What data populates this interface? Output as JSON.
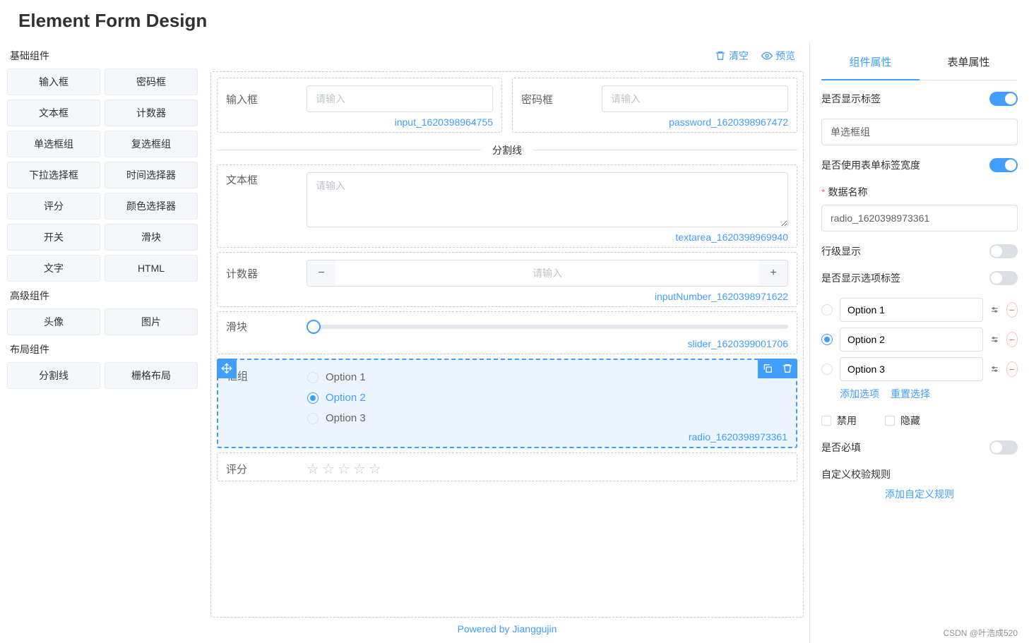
{
  "title": "Element Form Design",
  "sidebar": {
    "groups": [
      {
        "title": "基础组件",
        "items": [
          "输入框",
          "密码框",
          "文本框",
          "计数器",
          "单选框组",
          "复选框组",
          "下拉选择框",
          "时间选择器",
          "评分",
          "颜色选择器",
          "开关",
          "滑块",
          "文字",
          "HTML"
        ]
      },
      {
        "title": "高级组件",
        "items": [
          "头像",
          "图片"
        ]
      },
      {
        "title": "布局组件",
        "items": [
          "分割线",
          "栅格布局"
        ]
      }
    ]
  },
  "toolbar": {
    "clear": "清空",
    "preview": "预览"
  },
  "canvas": {
    "input": {
      "label": "输入框",
      "placeholder": "请输入",
      "id": "input_1620398964755"
    },
    "password": {
      "label": "密码框",
      "placeholder": "请输入",
      "id": "password_1620398967472"
    },
    "divider": {
      "text": "分割线"
    },
    "textarea": {
      "label": "文本框",
      "placeholder": "请输入",
      "id": "textarea_1620398969940"
    },
    "number": {
      "label": "计数器",
      "placeholder": "请输入",
      "id": "inputNumber_1620398971622"
    },
    "slider": {
      "label": "滑块",
      "id": "slider_1620399001706"
    },
    "radio": {
      "label": "框组",
      "id": "radio_1620398973361",
      "options": [
        "Option 1",
        "Option 2",
        "Option 3"
      ],
      "selected": 1
    },
    "rate": {
      "label": "评分"
    }
  },
  "footer": "Powered by Jianggujin",
  "props": {
    "tabs": {
      "component": "组件属性",
      "form": "表单属性"
    },
    "showLabel": {
      "label": "是否显示标签",
      "value": true
    },
    "labelText": "单选框组",
    "useFormLabelWidth": {
      "label": "是否使用表单标签宽度",
      "value": true
    },
    "dataName": {
      "label": "数据名称",
      "value": "radio_1620398973361",
      "required": true
    },
    "inline": {
      "label": "行级显示",
      "value": false
    },
    "showOptionLabel": {
      "label": "是否显示选项标签",
      "value": false
    },
    "options": [
      {
        "label": "Option 1",
        "checked": false
      },
      {
        "label": "Option 2",
        "checked": true
      },
      {
        "label": "Option 3",
        "checked": false
      }
    ],
    "addOption": "添加选项",
    "resetSelect": "重置选择",
    "disabled": "禁用",
    "hidden": "隐藏",
    "required": {
      "label": "是否必填",
      "value": false
    },
    "customRules": "自定义校验规则",
    "addCustomRule": "添加自定义规则"
  },
  "watermark": "CSDN @叶浩成520"
}
